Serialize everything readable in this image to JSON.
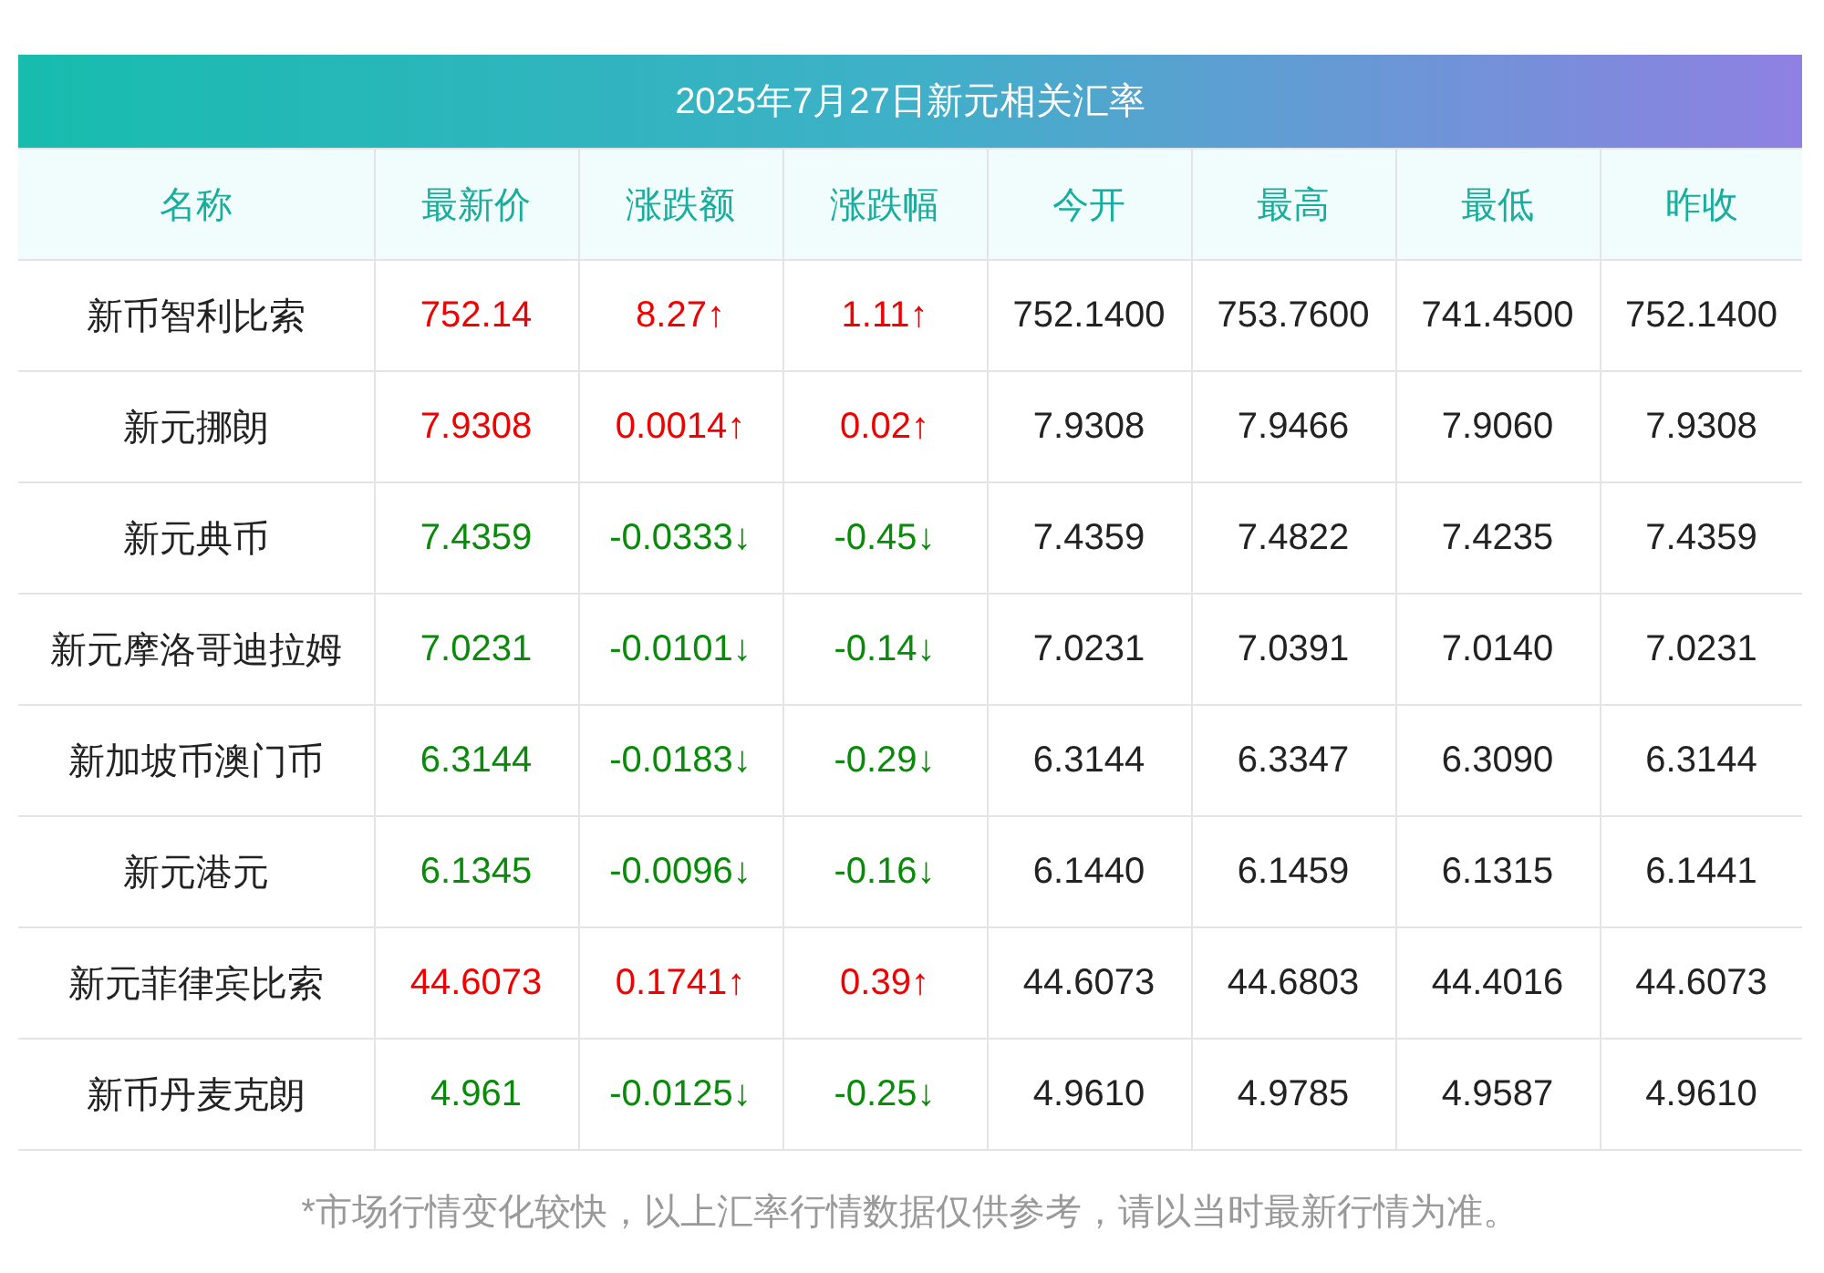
{
  "title": "2025年7月27日新元相关汇率",
  "columns": [
    "名称",
    "最新价",
    "涨跌额",
    "涨跌幅",
    "今开",
    "最高",
    "最低",
    "昨收"
  ],
  "rows": [
    {
      "name": "新币智利比索",
      "color": "#f00000",
      "latest": "752.14",
      "change": "8.27↑",
      "pct": "1.11↑",
      "open": "752.1400",
      "high": "753.7600",
      "low": "741.4500",
      "prev": "752.1400"
    },
    {
      "name": "新元挪朗",
      "color": "#f00000",
      "latest": "7.9308",
      "change": "0.0014↑",
      "pct": "0.02↑",
      "open": "7.9308",
      "high": "7.9466",
      "low": "7.9060",
      "prev": "7.9308"
    },
    {
      "name": "新元典币",
      "color": "#0a8a0a",
      "latest": "7.4359",
      "change": "-0.0333↓",
      "pct": "-0.45↓",
      "open": "7.4359",
      "high": "7.4822",
      "low": "7.4235",
      "prev": "7.4359"
    },
    {
      "name": "新元摩洛哥迪拉姆",
      "color": "#0a8a0a",
      "latest": "7.0231",
      "change": "-0.0101↓",
      "pct": "-0.14↓",
      "open": "7.0231",
      "high": "7.0391",
      "low": "7.0140",
      "prev": "7.0231"
    },
    {
      "name": "新加坡币澳门币",
      "color": "#0a8a0a",
      "latest": "6.3144",
      "change": "-0.0183↓",
      "pct": "-0.29↓",
      "open": "6.3144",
      "high": "6.3347",
      "low": "6.3090",
      "prev": "6.3144"
    },
    {
      "name": "新元港元",
      "color": "#0a8a0a",
      "latest": "6.1345",
      "change": "-0.0096↓",
      "pct": "-0.16↓",
      "open": "6.1440",
      "high": "6.1459",
      "low": "6.1315",
      "prev": "6.1441"
    },
    {
      "name": "新元菲律宾比索",
      "color": "#f00000",
      "latest": "44.6073",
      "change": "0.1741↑",
      "pct": "0.39↑",
      "open": "44.6073",
      "high": "44.6803",
      "low": "44.4016",
      "prev": "44.6073"
    },
    {
      "name": "新币丹麦克朗",
      "color": "#0a8a0a",
      "latest": "4.961",
      "change": "-0.0125↓",
      "pct": "-0.25↓",
      "open": "4.9610",
      "high": "4.9785",
      "low": "4.9587",
      "prev": "4.9610"
    }
  ],
  "footnote": "*市场行情变化较快，以上汇率行情数据仅供参考，请以当时最新行情为准。"
}
